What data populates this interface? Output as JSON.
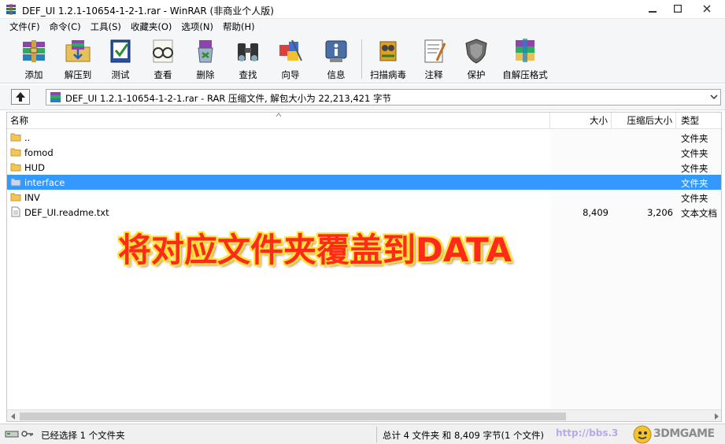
{
  "window": {
    "title": "DEF_UI 1.2.1-10654-1-2-1.rar - WinRAR (非商业个人版)"
  },
  "menu": [
    "文件(F)",
    "命令(C)",
    "工具(S)",
    "收藏夹(O)",
    "选项(N)",
    "帮助(H)"
  ],
  "toolbar": {
    "buttons": [
      {
        "label": "添加",
        "icon": "books-add-icon"
      },
      {
        "label": "解压到",
        "icon": "folder-extract-icon"
      },
      {
        "label": "测试",
        "icon": "test-check-icon"
      },
      {
        "label": "查看",
        "icon": "glasses-view-icon"
      },
      {
        "label": "删除",
        "icon": "recycle-delete-icon"
      },
      {
        "label": "查找",
        "icon": "binoculars-find-icon"
      },
      {
        "label": "向导",
        "icon": "wizard-icon"
      },
      {
        "label": "信息",
        "icon": "info-icon"
      },
      {
        "label": "扫描病毒",
        "icon": "virus-scan-icon"
      },
      {
        "label": "注释",
        "icon": "comment-icon"
      },
      {
        "label": "保护",
        "icon": "shield-protect-icon"
      },
      {
        "label": "自解压格式",
        "icon": "sfx-icon"
      }
    ]
  },
  "address": {
    "path": "DEF_UI 1.2.1-10654-1-2-1.rar - RAR 压缩文件, 解包大小为 22,213,421 字节"
  },
  "columns": {
    "name": "名称",
    "size": "大小",
    "packed": "压缩后大小",
    "type": "类型"
  },
  "files": [
    {
      "name": "..",
      "size": "",
      "packed": "",
      "type": "文件夹",
      "kind": "folder",
      "selected": false
    },
    {
      "name": "fomod",
      "size": "",
      "packed": "",
      "type": "文件夹",
      "kind": "folder",
      "selected": false
    },
    {
      "name": "HUD",
      "size": "",
      "packed": "",
      "type": "文件夹",
      "kind": "folder",
      "selected": false
    },
    {
      "name": "interface",
      "size": "",
      "packed": "",
      "type": "文件夹",
      "kind": "folder",
      "selected": true
    },
    {
      "name": "INV",
      "size": "",
      "packed": "",
      "type": "文件夹",
      "kind": "folder",
      "selected": false
    },
    {
      "name": "DEF_UI.readme.txt",
      "size": "8,409",
      "packed": "3,206",
      "type": "文本文档",
      "kind": "file",
      "selected": false
    }
  ],
  "overlay": {
    "text": "将对应文件夹覆盖到DATA"
  },
  "status": {
    "left": "已经选择 1 个文件夹",
    "right": "总计 4 文件夹 和 8,409 字节(1 个文件)",
    "watermark_url": "http://bbs.3",
    "watermark_logo": "3DMGAME"
  },
  "colors": {
    "selection": "#3399ff",
    "overlay_text": "#ff2a1a",
    "overlay_outline": "#ffe23a",
    "close_hover": "#c75050"
  }
}
